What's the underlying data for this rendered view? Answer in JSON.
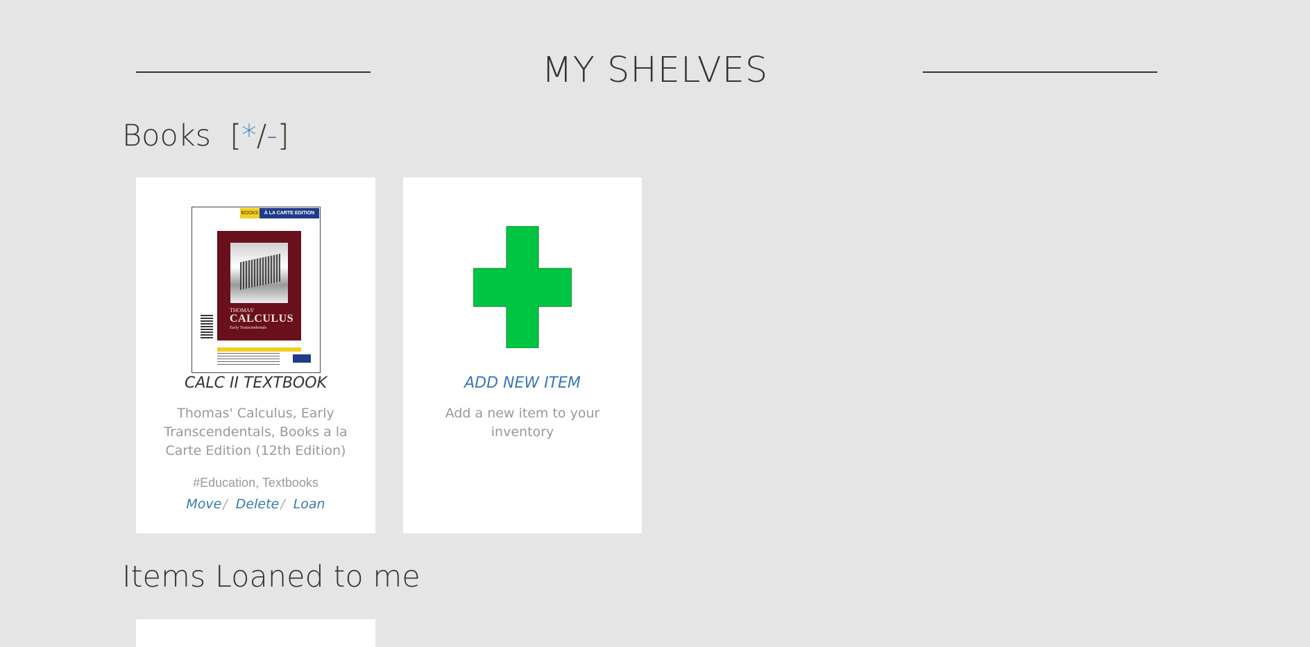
{
  "page": {
    "title": "MY SHELVES"
  },
  "sections": {
    "books": {
      "heading": "Books",
      "bracket_open": "[",
      "expand": "*",
      "slash": "/",
      "collapse": "-",
      "bracket_close": "]"
    },
    "loaned": {
      "heading": "Items Loaned to me"
    }
  },
  "items": [
    {
      "title": "CALC II TEXTBOOK",
      "description": "Thomas' Calculus, Early Transcendentals, Books a la Carte Edition (12th Edition)",
      "tags": "#Education, Textbooks",
      "actions": {
        "move": "Move",
        "delete": "Delete",
        "loan": "Loan",
        "separator": "/"
      },
      "cover": {
        "badge_left": "BOOKS",
        "badge_right": "À LA CARTE EDITION",
        "author_line": "THOMAS'",
        "title_line": "CALCULUS",
        "subtitle_line": "Early Transcendentals",
        "colors": {
          "cover": "#6a0f1c",
          "badge_blue": "#1f3c8a",
          "badge_yellow": "#f2cf1e"
        }
      }
    }
  ],
  "add_card": {
    "title": "ADD NEW ITEM",
    "description": "Add a new item to your inventory",
    "icon": "plus-icon",
    "icon_color": "#00c542"
  },
  "colors": {
    "background": "#e5e5e5",
    "link": "#3a77b8",
    "text": "#333333",
    "muted": "#999999"
  }
}
